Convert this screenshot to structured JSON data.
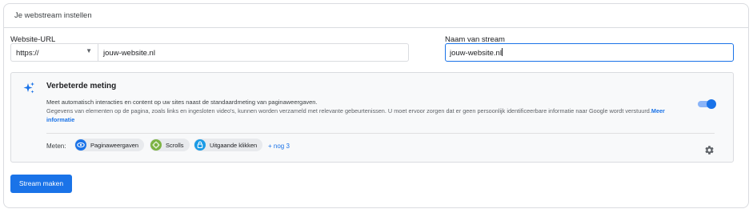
{
  "header": {
    "title": "Je webstream instellen"
  },
  "form": {
    "url_label": "Website-URL",
    "protocol_value": "https://",
    "url_value": "jouw-website.nl",
    "stream_label": "Naam van stream",
    "stream_value": "jouw-website.nl"
  },
  "enhanced": {
    "title": "Verbeterde meting",
    "description": "Meet automatisch interacties en content op uw sites naast de standaardmeting van paginaweergaven.",
    "details": "Gegevens van elementen op de pagina, zoals links en ingesloten video's, kunnen worden verzameld met relevante gebeurtenissen. U moet ervoor zorgen dat er geen persoonlijk identificeerbare informatie naar Google wordt verstuurd.",
    "more_info_label": "Meer informatie",
    "toggle_on": true,
    "measure_label": "Meten:",
    "chips": [
      {
        "label": "Paginaweergaven",
        "icon": "eye-icon",
        "color": "#1a73e8"
      },
      {
        "label": "Scrolls",
        "icon": "crosshair-icon",
        "color": "#7cb342"
      },
      {
        "label": "Uitgaande klikken",
        "icon": "lock-icon",
        "color": "#1a9be6"
      }
    ],
    "more_chips_label": "+ nog 3",
    "settings_icon": "gear-icon"
  },
  "actions": {
    "create_label": "Stream maken"
  },
  "colors": {
    "accent": "#1a73e8",
    "toggle_track": "#8ab4f8"
  }
}
